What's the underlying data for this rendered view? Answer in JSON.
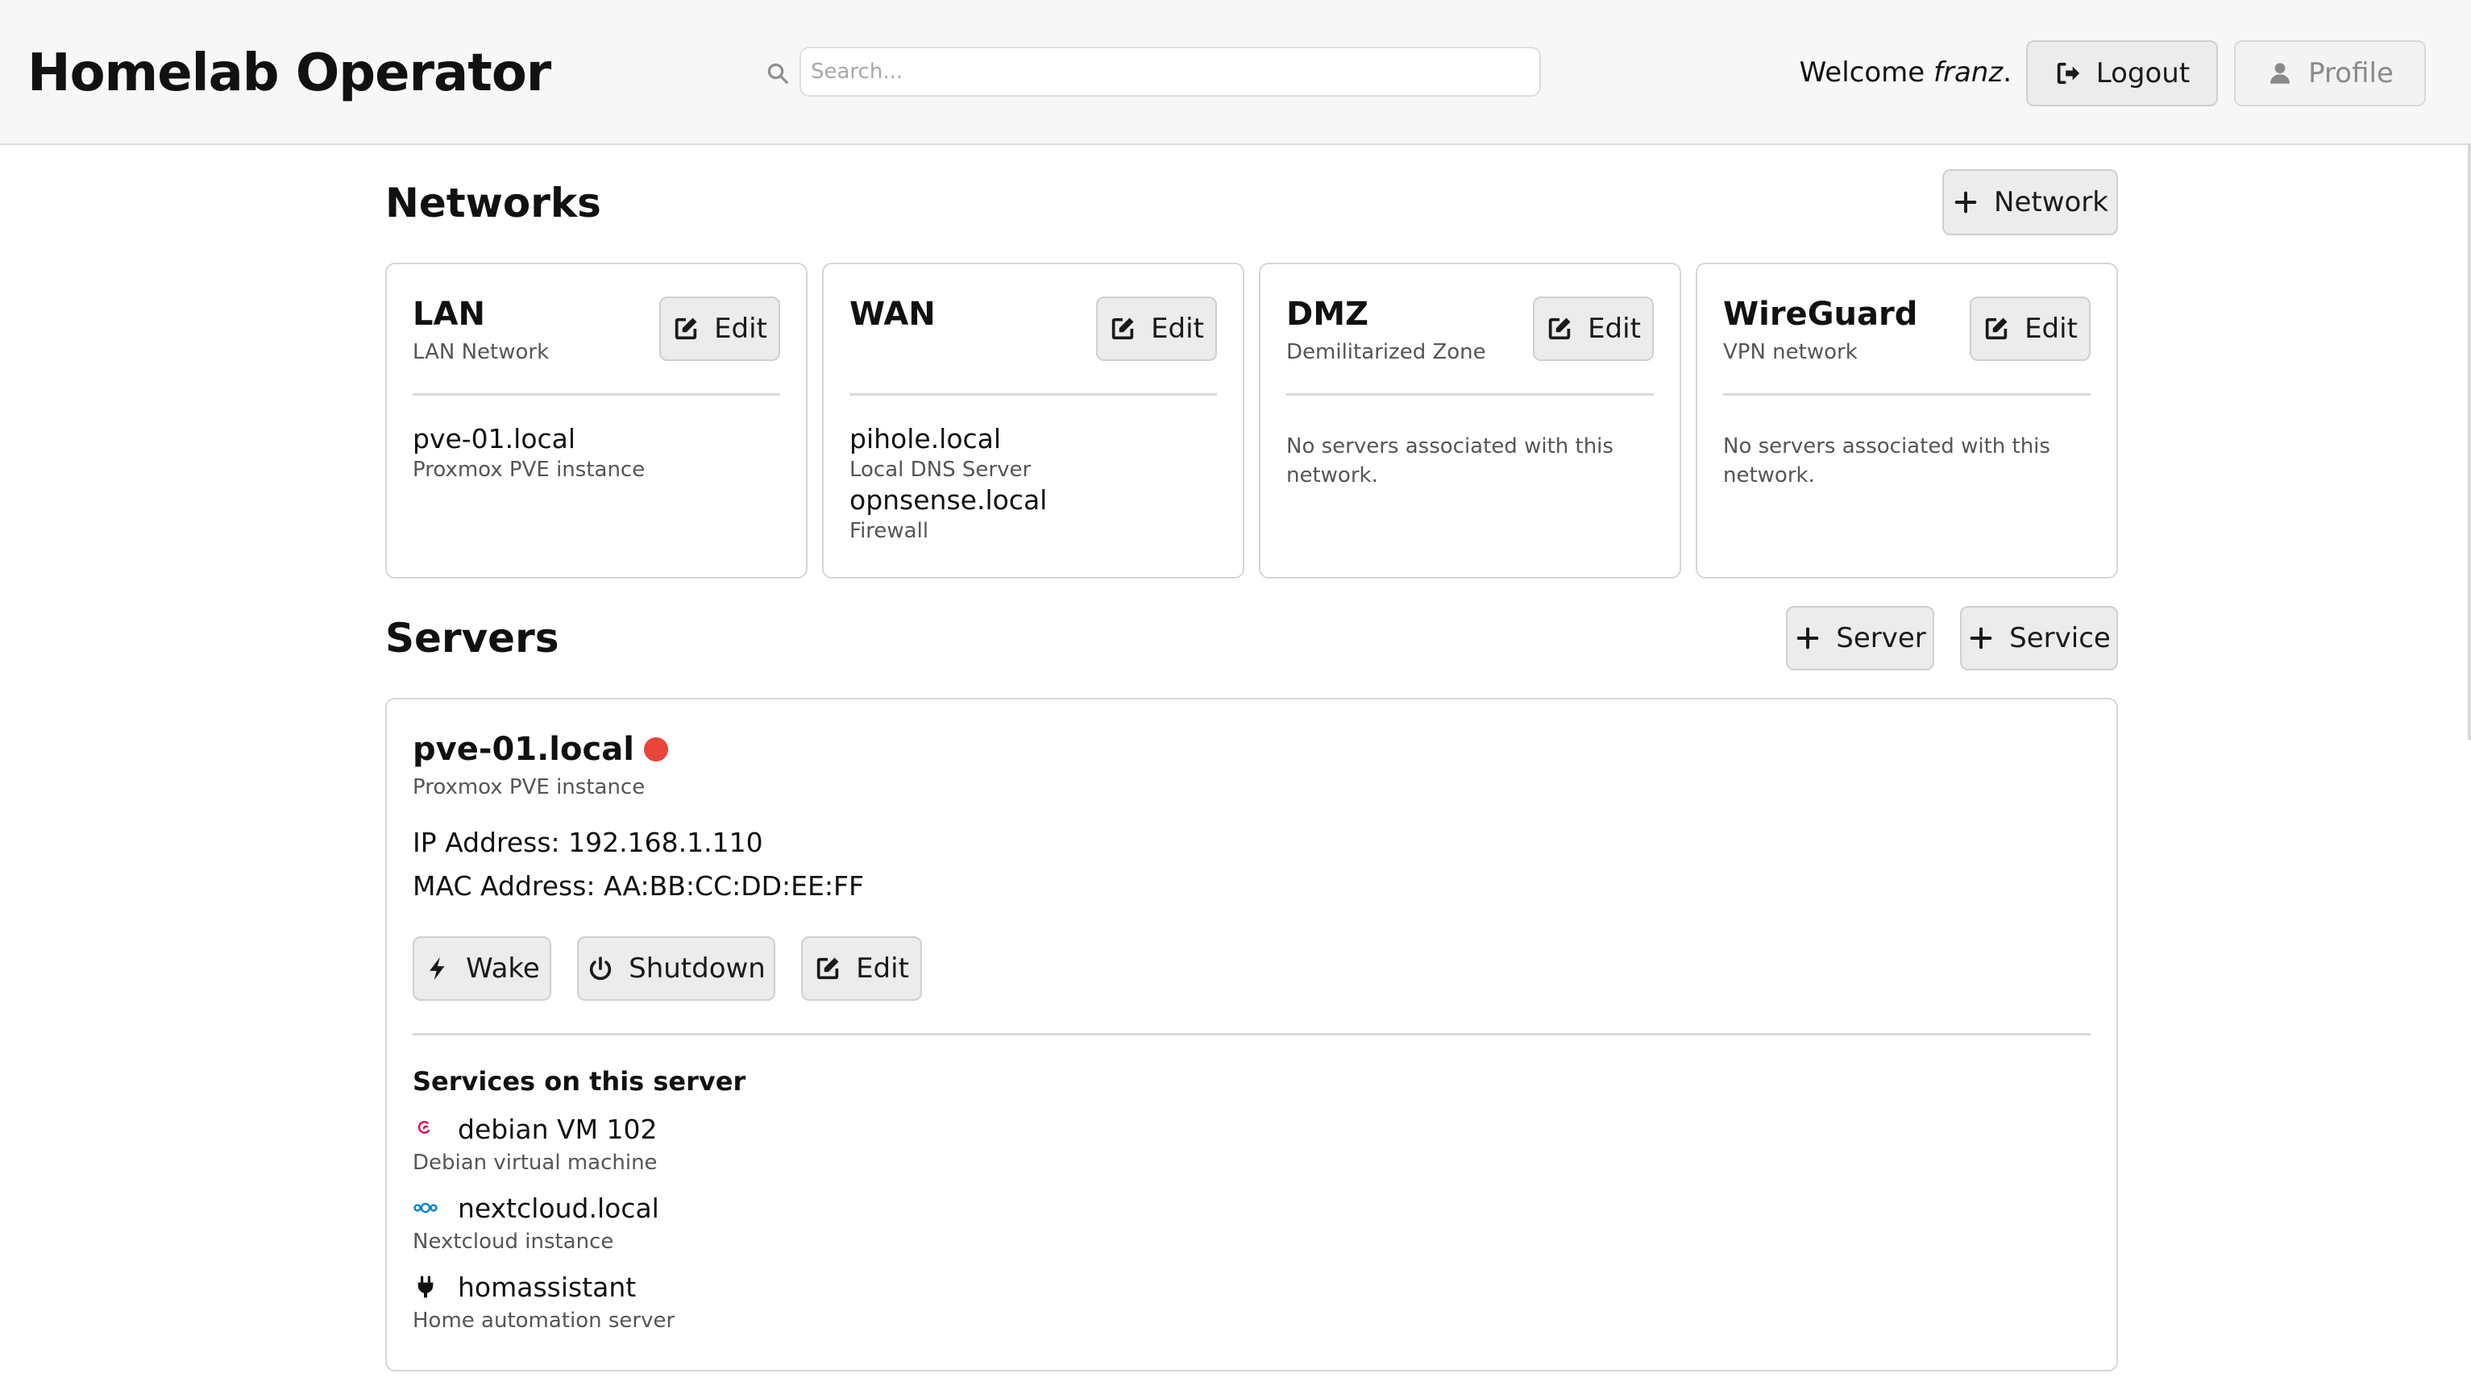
{
  "header": {
    "brand": "Homelab Operator",
    "search_placeholder": "Search...",
    "welcome_prefix": "Welcome ",
    "welcome_user": "franz",
    "welcome_suffix": ".",
    "logout_label": "Logout",
    "profile_label": "Profile"
  },
  "networks": {
    "title": "Networks",
    "add_label": "Network",
    "edit_label": "Edit",
    "empty_text": "No servers associated with this network.",
    "items": [
      {
        "name": "LAN",
        "description": "LAN Network",
        "servers": [
          {
            "name": "pve-01.local",
            "description": "Proxmox PVE instance"
          }
        ]
      },
      {
        "name": "WAN",
        "description": "",
        "servers": [
          {
            "name": "pihole.local",
            "description": "Local DNS Server"
          },
          {
            "name": "opnsense.local",
            "description": "Firewall"
          }
        ]
      },
      {
        "name": "DMZ",
        "description": "Demilitarized Zone",
        "servers": []
      },
      {
        "name": "WireGuard",
        "description": "VPN network",
        "servers": []
      }
    ]
  },
  "servers": {
    "title": "Servers",
    "add_server_label": "Server",
    "add_service_label": "Service",
    "items": [
      {
        "name": "pve-01.local",
        "status_color": "#e8453c",
        "description": "Proxmox PVE instance",
        "ip_line": "IP Address: 192.168.1.110",
        "mac_line": "MAC Address: AA:BB:CC:DD:EE:FF",
        "wake_label": "Wake",
        "shutdown_label": "Shutdown",
        "edit_label": "Edit",
        "services_title": "Services on this server",
        "services": [
          {
            "icon": "debian-icon",
            "icon_color": "#d70a53",
            "name": "debian VM 102",
            "description": "Debian virtual machine"
          },
          {
            "icon": "nextcloud-icon",
            "icon_color": "#0082c9",
            "name": "nextcloud.local",
            "description": "Nextcloud instance"
          },
          {
            "icon": "plug-icon",
            "icon_color": "#111111",
            "name": "homassistant",
            "description": "Home automation server"
          }
        ]
      }
    ]
  }
}
